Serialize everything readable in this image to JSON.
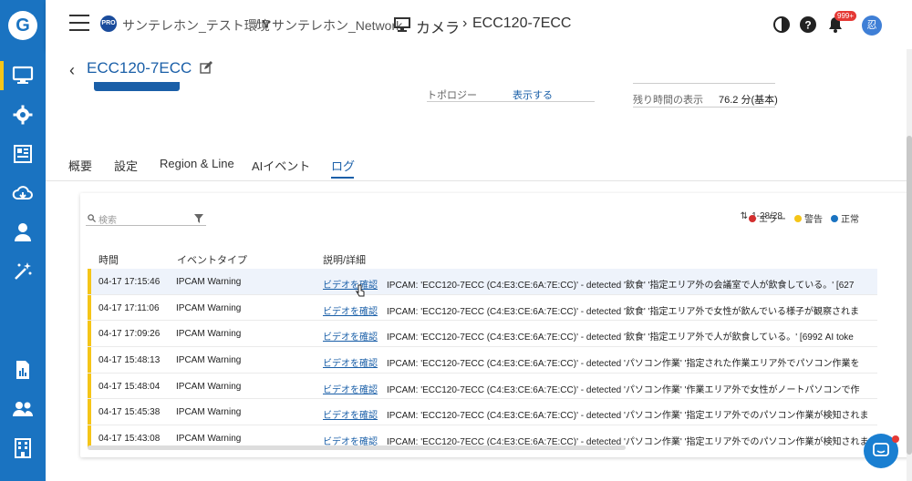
{
  "app": {
    "logo_letter": "G"
  },
  "sidebar": {
    "items": [
      {
        "name": "monitor-icon",
        "active": true
      },
      {
        "name": "gear-icon",
        "active": false
      },
      {
        "name": "news-icon",
        "active": false
      },
      {
        "name": "cloud-icon",
        "active": false
      },
      {
        "name": "user-icon",
        "active": false
      },
      {
        "name": "magic-wand-icon",
        "active": false
      },
      {
        "name": "report-icon",
        "active": false
      },
      {
        "name": "users-icon",
        "active": false
      },
      {
        "name": "building-icon",
        "active": false
      }
    ]
  },
  "header": {
    "pro_label": "PRO",
    "org": "サンテレホン_テスト環境",
    "sep": "/",
    "network": "サンテレホン_Network",
    "section": "カメラ",
    "arrow": "›",
    "device": "ECC120-7ECC",
    "notif_count": "999+",
    "avatar_text": "忍"
  },
  "page": {
    "title": "ECC120-7ECC",
    "topology_label": "トポロジー",
    "topology_value": "表示する",
    "remaining_label": "残り時間の表示",
    "remaining_value": "76.2 分(基本)"
  },
  "tabs": [
    {
      "label": "概要"
    },
    {
      "label": "設定"
    },
    {
      "label": "Region & Line"
    },
    {
      "label": "AIイベント"
    },
    {
      "label": "ログ",
      "active": true
    }
  ],
  "log": {
    "search_placeholder": "検索",
    "pager": "1-28/28",
    "legend": [
      {
        "label": "エラー",
        "color": "#d32f2f"
      },
      {
        "label": "警告",
        "color": "#f5c518"
      },
      {
        "label": "正常",
        "color": "#1a73c1"
      }
    ],
    "columns": [
      "時間",
      "イベントタイプ",
      "説明/詳細"
    ],
    "rows": [
      {
        "time": "04-17 17:15:46",
        "type": "IPCAM Warning",
        "link": "ビデオを確認",
        "detail": "IPCAM: 'ECC120-7ECC (C4:E3:CE:6A:7E:CC)' - detected '飲食' '指定エリア外の会議室で人が飲食している。' [627"
      },
      {
        "time": "04-17 17:11:06",
        "type": "IPCAM Warning",
        "link": "ビデオを確認",
        "detail": "IPCAM: 'ECC120-7ECC (C4:E3:CE:6A:7E:CC)' - detected '飲食' '指定エリア外で女性が飲んでいる様子が観察されま"
      },
      {
        "time": "04-17 17:09:26",
        "type": "IPCAM Warning",
        "link": "ビデオを確認",
        "detail": "IPCAM: 'ECC120-7ECC (C4:E3:CE:6A:7E:CC)' - detected '飲食' '指定エリア外で人が飲食している。' [6992 AI toke"
      },
      {
        "time": "04-17 15:48:13",
        "type": "IPCAM Warning",
        "link": "ビデオを確認",
        "detail": "IPCAM: 'ECC120-7ECC (C4:E3:CE:6A:7E:CC)' - detected 'パソコン作業' '指定された作業エリア外でパソコン作業を"
      },
      {
        "time": "04-17 15:48:04",
        "type": "IPCAM Warning",
        "link": "ビデオを確認",
        "detail": "IPCAM: 'ECC120-7ECC (C4:E3:CE:6A:7E:CC)' - detected 'パソコン作業' '作業エリア外で女性がノートパソコンで作"
      },
      {
        "time": "04-17 15:45:38",
        "type": "IPCAM Warning",
        "link": "ビデオを確認",
        "detail": "IPCAM: 'ECC120-7ECC (C4:E3:CE:6A:7E:CC)' - detected 'パソコン作業' '指定エリア外でのパソコン作業が検知されま"
      },
      {
        "time": "04-17 15:43:08",
        "type": "IPCAM Warning",
        "link": "ビデオを確認",
        "detail": "IPCAM: 'ECC120-7ECC (C4:E3:CE:6A:7E:CC)' - detected 'パソコン作業' '指定エリア外でのパソコン作業が検知されま"
      }
    ]
  }
}
